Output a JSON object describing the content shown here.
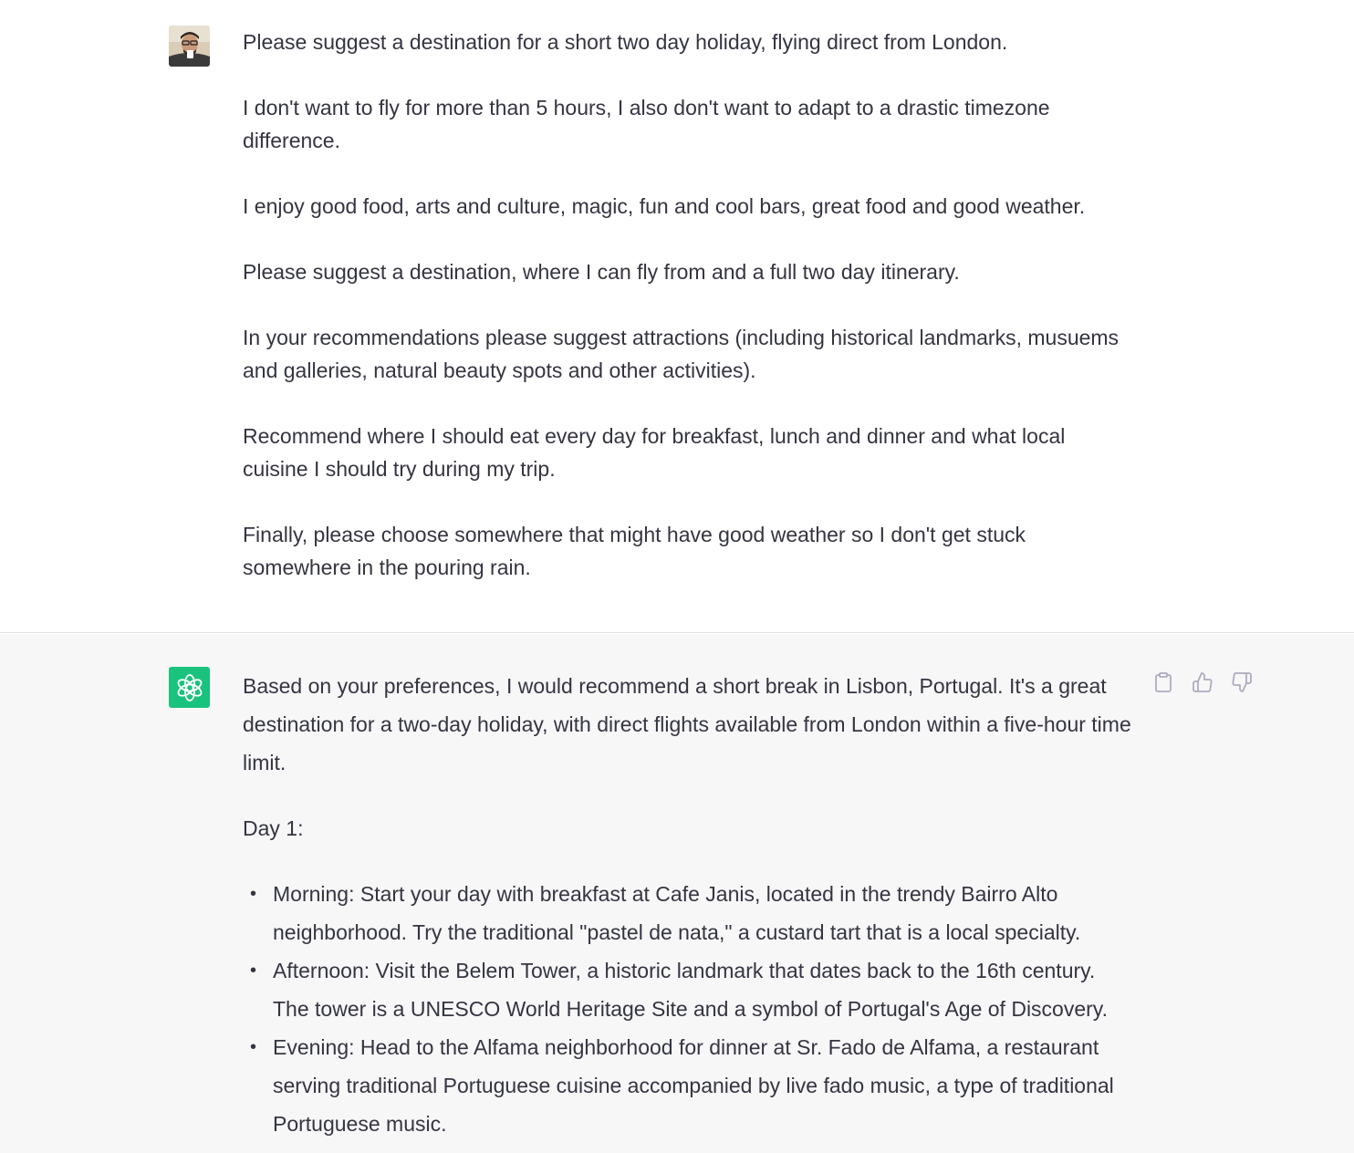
{
  "user_message": {
    "paragraphs": [
      "Please suggest a destination for a short two day holiday, flying direct from London.",
      "I don't want to fly for more than 5 hours, I also don't want to adapt to a drastic timezone difference.",
      "I enjoy good food, arts and culture, magic, fun and cool bars, great food and good weather.",
      "Please suggest a destination, where I can fly from and a full two day itinerary.",
      "In your recommendations please suggest attractions (including historical landmarks, musuems and galleries, natural beauty spots and other activities).",
      "Recommend where I should eat every day for breakfast, lunch and dinner and what local cuisine I should try during my trip.",
      "Finally, please choose somewhere that might have good weather so I don't get stuck somewhere in the pouring rain."
    ]
  },
  "assistant_message": {
    "intro": "Based on your preferences, I would recommend a short break in Lisbon, Portugal. It's a great destination for a two-day holiday, with direct flights available from London within a five-hour time limit.",
    "day_heading": "Day 1:",
    "items": [
      "Morning: Start your day with breakfast at Cafe Janis, located in the trendy Bairro Alto neighborhood. Try the traditional \"pastel de nata,\" a custard tart that is a local specialty.",
      "Afternoon: Visit the Belem Tower, a historic landmark that dates back to the 16th century. The tower is a UNESCO World Heritage Site and a symbol of Portugal's Age of Discovery.",
      "Evening: Head to the Alfama neighborhood for dinner at Sr. Fado de Alfama, a restaurant serving traditional Portuguese cuisine accompanied by live fado music, a type of traditional Portuguese music."
    ]
  },
  "icons": {
    "user_avatar": "user-avatar-photo",
    "assistant_avatar": "openai-logo-icon",
    "copy": "clipboard-icon",
    "like": "thumbs-up-icon",
    "dislike": "thumbs-down-icon"
  },
  "colors": {
    "assistant_avatar_bg": "#19c37d",
    "assistant_bg": "#f7f7f8",
    "text": "#343541"
  }
}
